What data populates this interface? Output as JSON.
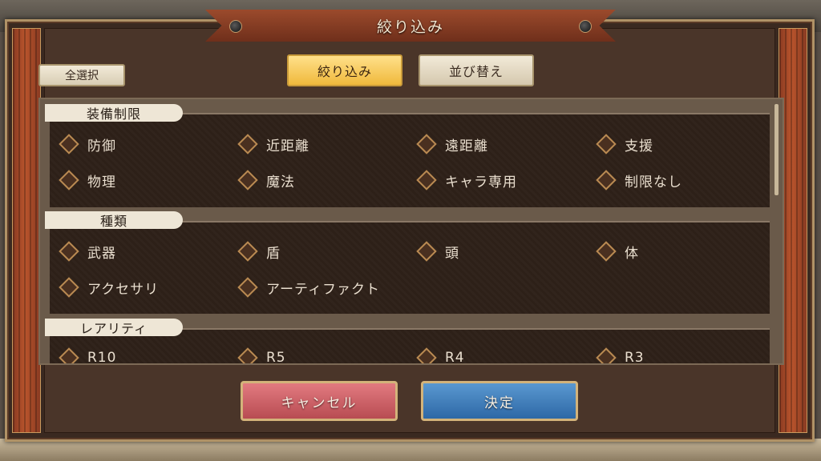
{
  "dialog": {
    "title": "絞り込み"
  },
  "toolbar": {
    "select_all": "全選択",
    "tabs": [
      {
        "label": "絞り込み",
        "active": true
      },
      {
        "label": "並び替え",
        "active": false
      }
    ]
  },
  "sections": [
    {
      "label": "装備制限",
      "options": [
        "防御",
        "近距離",
        "遠距離",
        "支援",
        "物理",
        "魔法",
        "キャラ専用",
        "制限なし"
      ]
    },
    {
      "label": "種類",
      "options": [
        "武器",
        "盾",
        "頭",
        "体",
        "アクセサリ",
        "アーティファクト"
      ]
    },
    {
      "label": "レアリティ",
      "options": [
        "R10",
        "R5",
        "R4",
        "R3"
      ]
    }
  ],
  "footer": {
    "cancel": "キャンセル",
    "confirm": "決定"
  },
  "colors": {
    "accent_tab": "#f0b93c",
    "cancel": "#c85a60",
    "confirm": "#3a78b8",
    "panel": "#2d2018"
  }
}
